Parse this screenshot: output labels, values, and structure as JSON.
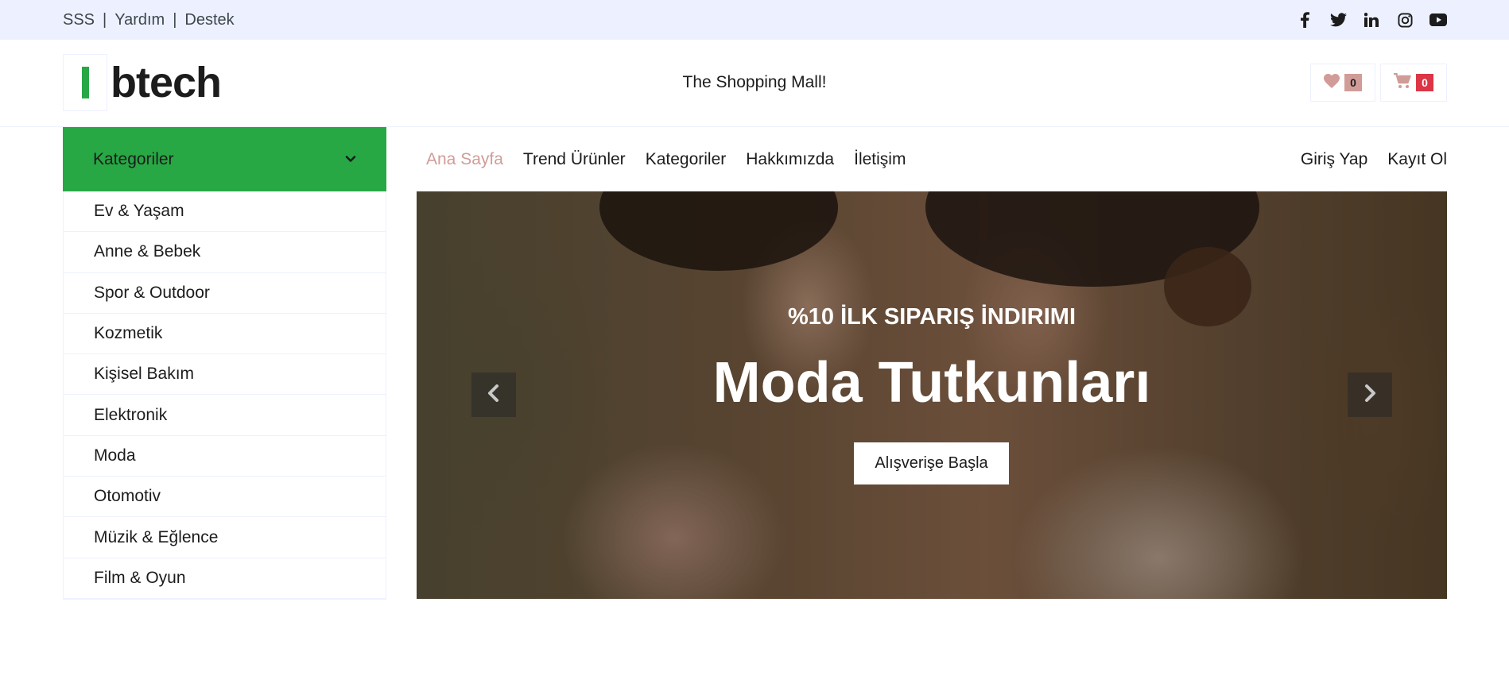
{
  "topbar": {
    "links": [
      "SSS",
      "Yardım",
      "Destek"
    ],
    "separator": "|",
    "social_icons": [
      "facebook-icon",
      "twitter-icon",
      "linkedin-icon",
      "instagram-icon",
      "youtube-icon"
    ]
  },
  "header": {
    "logo_text": "btech",
    "tagline": "The Shopping Mall!",
    "wishlist_count": "0",
    "cart_count": "0"
  },
  "sidebar": {
    "title": "Kategoriler",
    "items": [
      "Ev & Yaşam",
      "Anne & Bebek",
      "Spor & Outdoor",
      "Kozmetik",
      "Kişisel Bakım",
      "Elektronik",
      "Moda",
      "Otomotiv",
      "Müzik & Eğlence",
      "Film & Oyun"
    ]
  },
  "nav": {
    "items": [
      "Ana Sayfa",
      "Trend Ürünler",
      "Kategoriler",
      "Hakkımızda",
      "İletişim"
    ],
    "active": "Ana Sayfa",
    "auth": [
      "Giriş Yap",
      "Kayıt Ol"
    ]
  },
  "hero": {
    "subtitle": "%10 İLK SIPARIŞ İNDIRIMI",
    "title": "Moda Tutkunları",
    "cta": "Alışverişe Başla"
  },
  "colors": {
    "topbar_bg": "#edf1ff",
    "primary_green": "#28a745",
    "accent_pink": "#d19c97",
    "cart_badge": "#dc3545",
    "text_dark": "#1c1c1c"
  }
}
